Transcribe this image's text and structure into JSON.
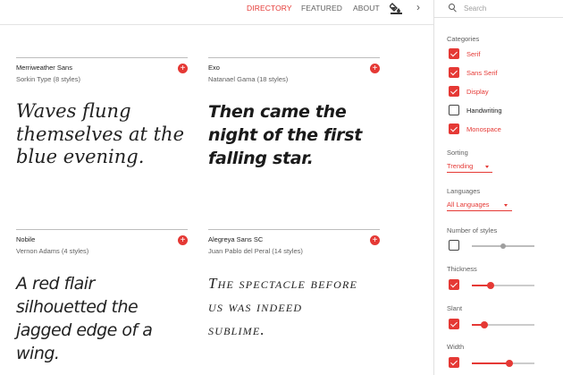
{
  "nav": {
    "directory": "DIRECTORY",
    "featured": "FEATURED",
    "about": "ABOUT",
    "next_symbol": "›"
  },
  "cards": [
    {
      "font": "Merriweather Sans",
      "designer": "Sorkin Type (8 styles)",
      "sample": "Waves flung\nthemselves at the\nblue evening."
    },
    {
      "font": "Exo",
      "designer": "Natanael Gama (18 styles)",
      "sample": "Then came the\nnight of the first\nfalling star."
    },
    {
      "font": "Nobile",
      "designer": "Vernon Adams (4 styles)",
      "sample": "A red flair\nsilhouetted the\njagged edge of a\nwing."
    },
    {
      "font": "Alegreya Sans SC",
      "designer": "Juan Pablo del Peral (14 styles)",
      "sample": "The spectacle before\nus was indeed\nsublime."
    }
  ],
  "add_symbol": "+",
  "sidebar": {
    "search_placeholder": "Search",
    "categories_label": "Categories",
    "categories": [
      {
        "label": "Serif",
        "checked": true
      },
      {
        "label": "Sans Serif",
        "checked": true
      },
      {
        "label": "Display",
        "checked": true
      },
      {
        "label": "Handwriting",
        "checked": false
      },
      {
        "label": "Monospace",
        "checked": true
      }
    ],
    "sorting_label": "Sorting",
    "sorting_value": "Trending",
    "languages_label": "Languages",
    "languages_value": "All Languages",
    "number_of_styles_label": "Number of styles",
    "number_of_styles": {
      "enabled": false,
      "level": 0.5
    },
    "thickness_label": "Thickness",
    "thickness": {
      "enabled": true,
      "level": 0.3
    },
    "slant_label": "Slant",
    "slant": {
      "enabled": true,
      "level": 0.2
    },
    "width_label": "Width",
    "width": {
      "enabled": true,
      "level": 0.6
    }
  },
  "colors": {
    "accent": "#e53935",
    "text": "#212121",
    "muted": "#616161"
  }
}
